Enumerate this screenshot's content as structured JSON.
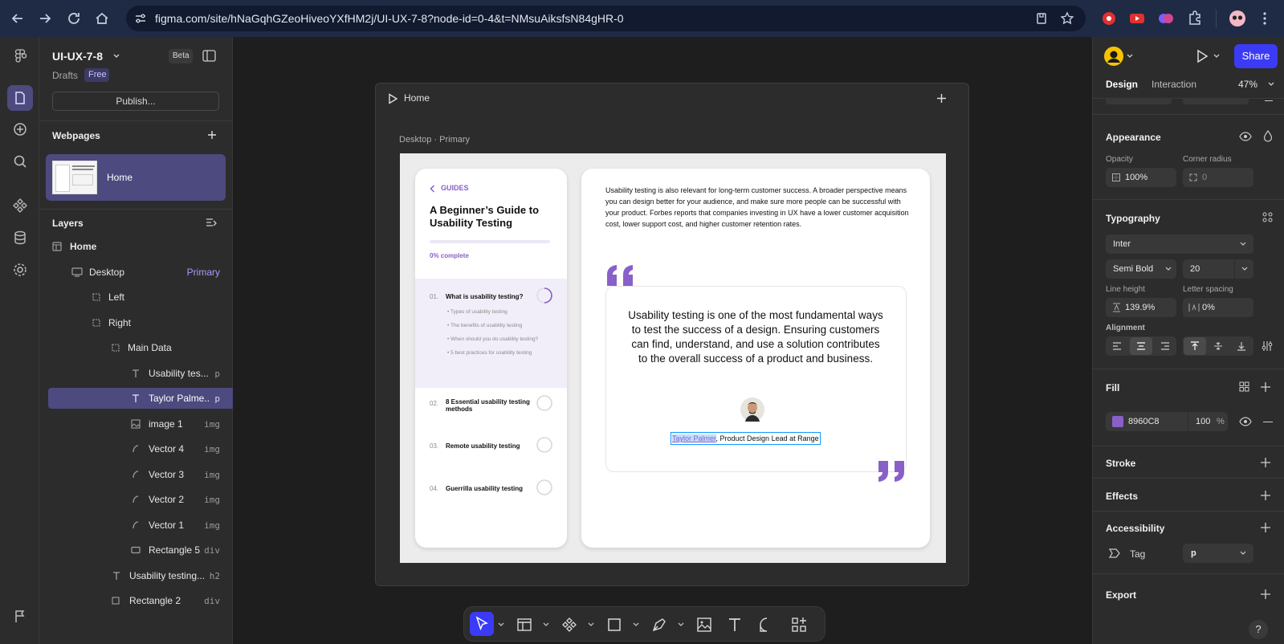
{
  "browser": {
    "url": "figma.com/site/hNaGqhGZeoHiveoYXfHM2j/UI-UX-7-8?node-id=0-4&t=NMsuAiksfsN84gHR-0"
  },
  "file": {
    "name": "UI-UX-7-8",
    "beta_badge": "Beta",
    "location": "Drafts",
    "plan_badge": "Free",
    "publish_label": "Publish..."
  },
  "webpages": {
    "title": "Webpages",
    "items": [
      {
        "label": "Home"
      }
    ]
  },
  "layers": {
    "title": "Layers",
    "items": [
      {
        "name": "Home",
        "tag": ""
      },
      {
        "name": "Desktop",
        "tag": "Primary"
      },
      {
        "name": "Left",
        "tag": ""
      },
      {
        "name": "Right",
        "tag": ""
      },
      {
        "name": "Main Data",
        "tag": ""
      },
      {
        "name": "Usability tes...",
        "tag": "p"
      },
      {
        "name": "Taylor Palme...",
        "tag": "p"
      },
      {
        "name": "image 1",
        "tag": "img"
      },
      {
        "name": "Vector 4",
        "tag": "img"
      },
      {
        "name": "Vector 3",
        "tag": "img"
      },
      {
        "name": "Vector 2",
        "tag": "img"
      },
      {
        "name": "Vector 1",
        "tag": "img"
      },
      {
        "name": "Rectangle 5",
        "tag": "div"
      },
      {
        "name": "Usability testing...",
        "tag": "h2"
      },
      {
        "name": "Rectangle 2",
        "tag": "div"
      }
    ]
  },
  "canvas": {
    "frame_title": "Home",
    "page_label": "Desktop · Primary",
    "left_card": {
      "back_label": "GUIDES",
      "heading_line1": "A Beginner’s Guide to",
      "heading_line2": "Usability Testing",
      "progress_text": "0% complete",
      "progress_value": 0,
      "sections": [
        {
          "num": "01.",
          "title": "What is usability testing?",
          "subs": [
            "Types of usability testing",
            "The benefits of usability testing",
            "When should you do usability testing?",
            "5 best practices for usability testing"
          ]
        },
        {
          "num": "02.",
          "title": "8 Essential usability testing methods"
        },
        {
          "num": "03.",
          "title": "Remote usability testing"
        },
        {
          "num": "04.",
          "title": "Guerrilla usability testing"
        }
      ]
    },
    "right_card": {
      "paragraph": "Usability testing is also relevant for long-term customer success. A broader perspective means you can design better for your audience, and make sure more people can be successful with your product. Forbes reports that companies investing in UX have a lower customer acquisition cost, lower support cost, and higher customer retention rates.",
      "quote": "Usability testing is one of the most fundamental ways to test the success of a design. Ensuring customers can find, understand, and use a solution contributes to the overall success of a product and business.",
      "author_name": "Taylor Palmer",
      "author_role": ", Product Design Lead at Range"
    }
  },
  "right_panel": {
    "share_label": "Share",
    "tabs": [
      {
        "label": "Design"
      },
      {
        "label": "Interaction"
      }
    ],
    "zoom": "47%",
    "appearance": {
      "title": "Appearance",
      "opacity_label": "Opacity",
      "opacity": "100%",
      "radius_label": "Corner radius",
      "radius": "0"
    },
    "typography": {
      "title": "Typography",
      "font": "Inter",
      "weight": "Semi Bold",
      "size": "20",
      "line_height_label": "Line height",
      "line_height": "139.9%",
      "letter_spacing_label": "Letter spacing",
      "letter_spacing": "0%",
      "alignment_label": "Alignment"
    },
    "fill": {
      "title": "Fill",
      "hex": "8960C8",
      "opacity": "100",
      "unit": "%"
    },
    "stroke_title": "Stroke",
    "effects_title": "Effects",
    "accessibility": {
      "title": "Accessibility",
      "tag_label": "Tag",
      "tag_value": "p"
    },
    "export_title": "Export"
  },
  "colors": {
    "accent": "#8960C8",
    "figma_blue": "#0d99ff",
    "share_blue": "#3b3bf5",
    "selection": "#4c4a7e"
  }
}
